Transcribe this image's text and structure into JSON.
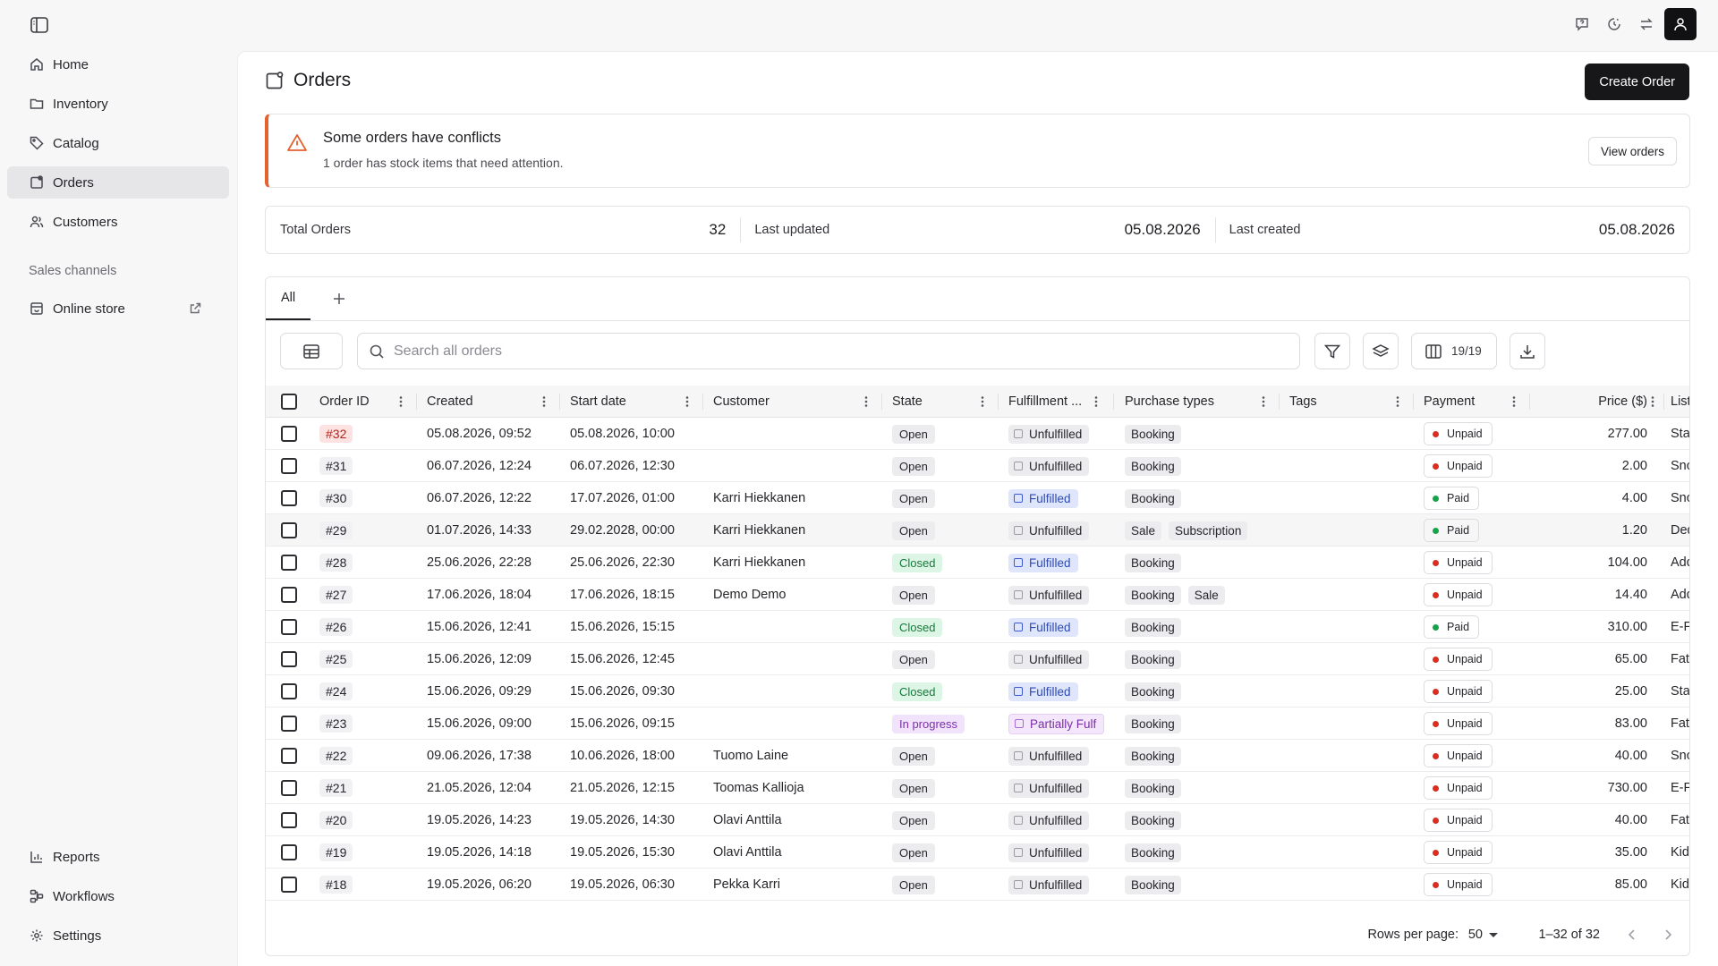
{
  "nav": {
    "items": [
      {
        "label": "Home",
        "icon": "home-icon"
      },
      {
        "label": "Inventory",
        "icon": "folder-icon"
      },
      {
        "label": "Catalog",
        "icon": "tag-icon"
      },
      {
        "label": "Orders",
        "icon": "orders-icon",
        "active": true
      },
      {
        "label": "Customers",
        "icon": "users-icon"
      }
    ],
    "section_label": "Sales channels",
    "store_label": "Online store",
    "bottom": [
      {
        "label": "Reports",
        "icon": "chart-icon"
      },
      {
        "label": "Workflows",
        "icon": "workflow-icon"
      },
      {
        "label": "Settings",
        "icon": "gear-icon"
      }
    ]
  },
  "page": {
    "title": "Orders",
    "create_label": "Create Order"
  },
  "alert": {
    "title": "Some orders have conflicts",
    "subtitle": "1 order has stock items that need attention.",
    "button": "View orders"
  },
  "stats": [
    {
      "label": "Total Orders",
      "value": "32"
    },
    {
      "label": "Last updated",
      "value": "05.08.2026"
    },
    {
      "label": "Last created",
      "value": "05.08.2026"
    }
  ],
  "tabs": [
    {
      "label": "All"
    }
  ],
  "toolbar": {
    "search_placeholder": "Search all orders",
    "columns_count": "19/19"
  },
  "columns": [
    "Order ID",
    "Created",
    "Start date",
    "Customer",
    "State",
    "Fulfillment ...",
    "Purchase types",
    "Tags",
    "Payment",
    "Price ($)",
    "Listing"
  ],
  "rows": [
    {
      "id": "#32",
      "conflict": true,
      "created": "05.08.2026, 09:52",
      "start": "05.08.2026, 10:00",
      "customer": "",
      "state": "Open",
      "fulfillment": "Unfulfilled",
      "types": [
        "Booking"
      ],
      "payment": "Unpaid",
      "price": "277.00",
      "listing": "Standa"
    },
    {
      "id": "#31",
      "created": "06.07.2026, 12:24",
      "start": "06.07.2026, 12:30",
      "customer": "",
      "state": "Open",
      "fulfillment": "Unfulfilled",
      "types": [
        "Booking"
      ],
      "payment": "Unpaid",
      "price": "2.00",
      "listing": "Snowb"
    },
    {
      "id": "#30",
      "created": "06.07.2026, 12:22",
      "start": "17.07.2026, 01:00",
      "customer": "Karri Hiekkanen",
      "state": "Open",
      "fulfillment": "Fulfilled",
      "types": [
        "Booking"
      ],
      "payment": "Paid",
      "price": "4.00",
      "listing": "Snowb"
    },
    {
      "id": "#29",
      "highlight": true,
      "created": "01.07.2026, 14:33",
      "start": "29.02.2028, 00:00",
      "customer": "Karri Hiekkanen",
      "state": "Open",
      "fulfillment": "Unfulfilled",
      "types": [
        "Sale",
        "Subscription"
      ],
      "payment": "Paid",
      "price": "1.20",
      "listing": "Deduc"
    },
    {
      "id": "#28",
      "created": "25.06.2026, 22:28",
      "start": "25.06.2026, 22:30",
      "customer": "Karri Hiekkanen",
      "state": "Closed",
      "fulfillment": "Fulfilled",
      "types": [
        "Booking"
      ],
      "payment": "Unpaid",
      "price": "104.00",
      "listing": "Add-o"
    },
    {
      "id": "#27",
      "created": "17.06.2026, 18:04",
      "start": "17.06.2026, 18:15",
      "customer": "Demo Demo",
      "state": "Open",
      "fulfillment": "Unfulfilled",
      "types": [
        "Booking",
        "Sale"
      ],
      "payment": "Unpaid",
      "price": "14.40",
      "listing": "Add-o"
    },
    {
      "id": "#26",
      "created": "15.06.2026, 12:41",
      "start": "15.06.2026, 15:15",
      "customer": "",
      "state": "Closed",
      "fulfillment": "Fulfilled",
      "types": [
        "Booking"
      ],
      "payment": "Paid",
      "price": "310.00",
      "listing": "E-Fatb"
    },
    {
      "id": "#25",
      "created": "15.06.2026, 12:09",
      "start": "15.06.2026, 12:45",
      "customer": "",
      "state": "Open",
      "fulfillment": "Unfulfilled",
      "types": [
        "Booking"
      ],
      "payment": "Unpaid",
      "price": "65.00",
      "listing": "Fatbik"
    },
    {
      "id": "#24",
      "created": "15.06.2026, 09:29",
      "start": "15.06.2026, 09:30",
      "customer": "",
      "state": "Closed",
      "fulfillment": "Fulfilled",
      "types": [
        "Booking"
      ],
      "payment": "Unpaid",
      "price": "25.00",
      "listing": "Standa"
    },
    {
      "id": "#23",
      "created": "15.06.2026, 09:00",
      "start": "15.06.2026, 09:15",
      "customer": "",
      "state": "In progress",
      "fulfillment": "Partially Fulf",
      "types": [
        "Booking"
      ],
      "payment": "Unpaid",
      "price": "83.00",
      "listing": "Fatbik"
    },
    {
      "id": "#22",
      "created": "09.06.2026, 17:38",
      "start": "10.06.2026, 18:00",
      "customer": "Tuomo Laine",
      "state": "Open",
      "fulfillment": "Unfulfilled",
      "types": [
        "Booking"
      ],
      "payment": "Unpaid",
      "price": "40.00",
      "listing": "Snowb"
    },
    {
      "id": "#21",
      "created": "21.05.2026, 12:04",
      "start": "21.05.2026, 12:15",
      "customer": "Toomas Kallioja",
      "state": "Open",
      "fulfillment": "Unfulfilled",
      "types": [
        "Booking"
      ],
      "payment": "Unpaid",
      "price": "730.00",
      "listing": "E-Fatb"
    },
    {
      "id": "#20",
      "created": "19.05.2026, 14:23",
      "start": "19.05.2026, 14:30",
      "customer": "Olavi Anttila",
      "state": "Open",
      "fulfillment": "Unfulfilled",
      "types": [
        "Booking"
      ],
      "payment": "Unpaid",
      "price": "40.00",
      "listing": "Fatbik"
    },
    {
      "id": "#19",
      "created": "19.05.2026, 14:18",
      "start": "19.05.2026, 15:30",
      "customer": "Olavi Anttila",
      "state": "Open",
      "fulfillment": "Unfulfilled",
      "types": [
        "Booking"
      ],
      "payment": "Unpaid",
      "price": "35.00",
      "listing": "Kids E"
    },
    {
      "id": "#18",
      "created": "19.05.2026, 06:20",
      "start": "19.05.2026, 06:30",
      "customer": "Pekka Karri",
      "state": "Open",
      "fulfillment": "Unfulfilled",
      "types": [
        "Booking"
      ],
      "payment": "Unpaid",
      "price": "85.00",
      "listing": "Kids E"
    }
  ],
  "footer": {
    "rows_per_page_label": "Rows per page:",
    "rows_per_page": "50",
    "range": "1–32 of 32"
  },
  "colors": {
    "accent_dark": "#17171a",
    "warning": "#e5622e",
    "unpaid": "#d92d20",
    "paid": "#16a34a",
    "fulfilled": "#2d4bb3",
    "closed": "#177a3c",
    "in_progress": "#7a2fa8"
  }
}
